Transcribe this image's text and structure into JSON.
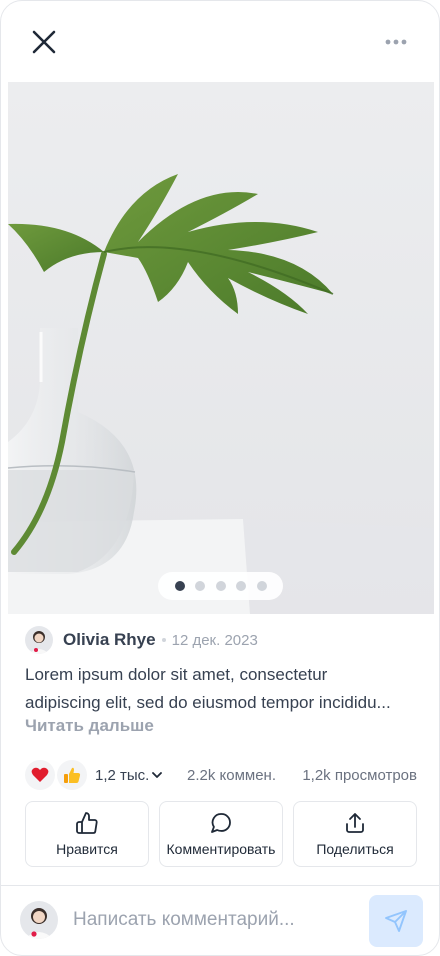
{
  "colors": {
    "accent_light": "#dbeafe",
    "accent_icon": "#93c5fd",
    "text_primary": "#374151",
    "text_muted": "#9ca3af",
    "dot_active": "#374151",
    "dot_inactive": "#d1d5db"
  },
  "header": {
    "close_icon": "close-icon",
    "more_icon": "more-horizontal-icon"
  },
  "carousel": {
    "image_alt": "monstera-leaf-in-glass-vase",
    "total": 5,
    "active_index": 0
  },
  "post": {
    "author": "Olivia Rhye",
    "date": "12 дек. 2023",
    "caption_line1": "Lorem ipsum dolor sit amet, consectetur",
    "caption_line2": "adipiscing elit, sed do eiusmod tempor incididu...",
    "read_more": "Читать дальше"
  },
  "stats": {
    "reactions": [
      "heart-icon",
      "thumbs-up-icon"
    ],
    "reaction_count": "1,2 тыс.",
    "comments": "2.2k коммен.",
    "views": "1,2k просмотров"
  },
  "actions": {
    "like": "Нравится",
    "comment": "Комментировать",
    "share": "Поделиться"
  },
  "composer": {
    "placeholder": "Написать комментарий...",
    "value": "",
    "send_icon": "send-icon"
  }
}
